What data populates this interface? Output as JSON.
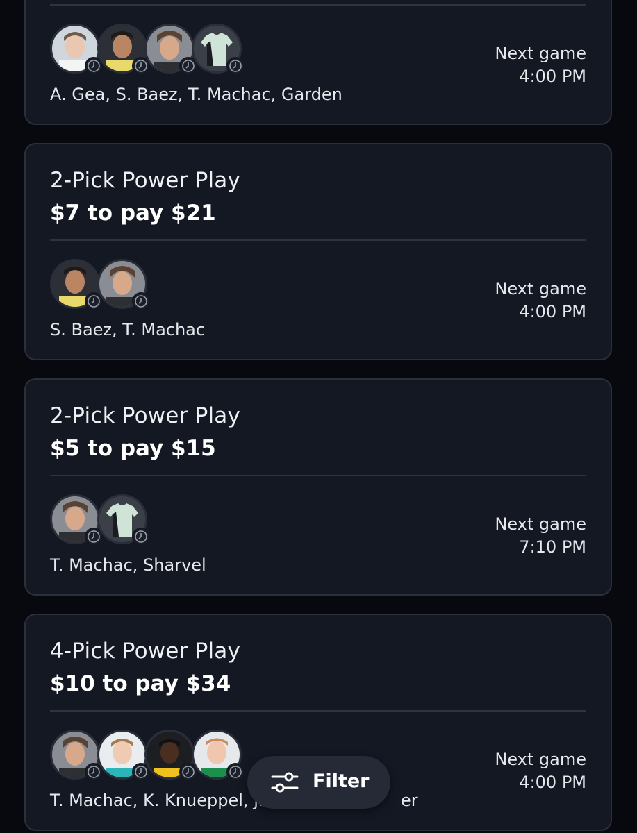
{
  "cards": [
    {
      "title": "",
      "amount": "",
      "names": "A. Gea, S. Baez, T. Machac, Garden",
      "next_label": "Next game",
      "next_time": "4:00 PM",
      "avatars": [
        "player-photo",
        "player-photo",
        "player-photo",
        "jersey-icon"
      ]
    },
    {
      "title": "2-Pick Power Play",
      "amount": "$7 to pay $21",
      "names": "S. Baez, T. Machac",
      "next_label": "Next game",
      "next_time": "4:00 PM",
      "avatars": [
        "player-photo",
        "player-photo"
      ]
    },
    {
      "title": "2-Pick Power Play",
      "amount": "$5 to pay $15",
      "names": "T. Machac, Sharvel",
      "next_label": "Next game",
      "next_time": "7:10 PM",
      "avatars": [
        "player-photo",
        "jersey-icon"
      ]
    },
    {
      "title": "4-Pick Power Play",
      "amount": "$10 to pay $34",
      "names": "T. Machac, K. Knueppel, J.",
      "names_tail": "er",
      "next_label": "Next game",
      "next_time": "4:00 PM",
      "avatars": [
        "player-photo",
        "player-photo",
        "player-photo",
        "player-photo"
      ]
    }
  ],
  "filter": {
    "label": "Filter",
    "icon": "sliders-icon"
  },
  "colors": {
    "background": "#07090f",
    "card": "#141823",
    "card_border": "#2a2f3a",
    "text": "#f2f3f5"
  }
}
